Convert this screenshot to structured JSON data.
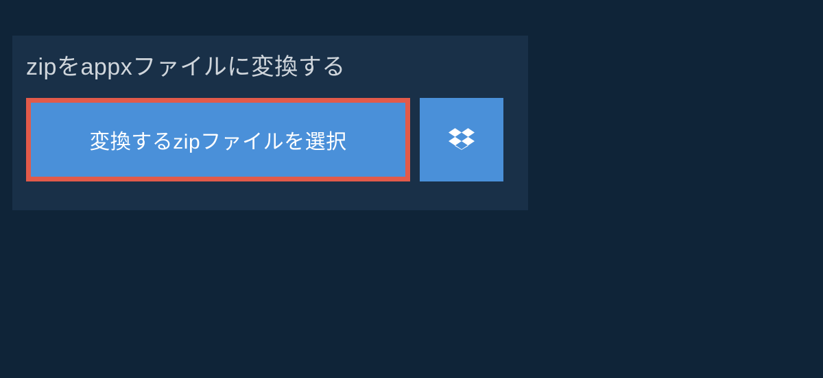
{
  "heading": {
    "title": "zipをappxファイルに変換する"
  },
  "buttons": {
    "select_label": "変換するzipファイルを選択"
  },
  "colors": {
    "background": "#0f2438",
    "panel": "#193048",
    "button_primary": "#4a90d9",
    "button_highlight_border": "#e25a4a",
    "text": "#d0d6dc"
  }
}
